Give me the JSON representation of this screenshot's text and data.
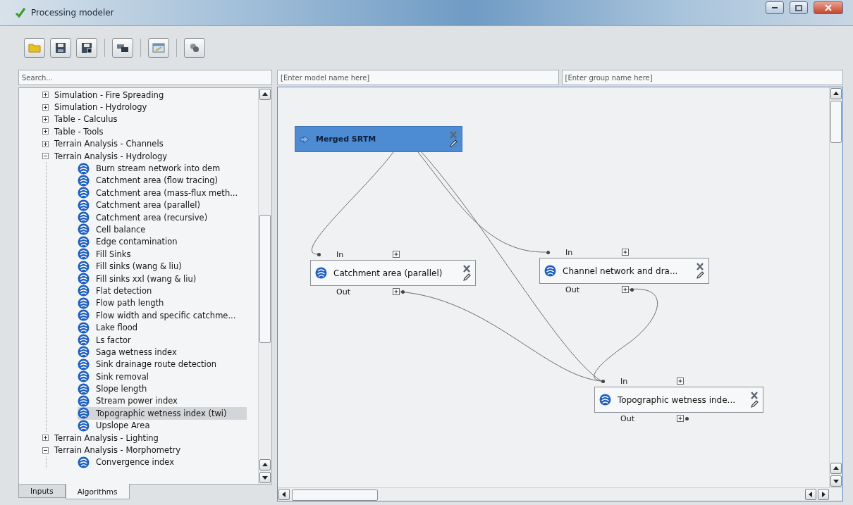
{
  "window": {
    "title": "Processing modeler"
  },
  "search": {
    "placeholder": "Search..."
  },
  "tree": [
    {
      "label": "Simulation - Fire Spreading",
      "expanded": false,
      "selected": false
    },
    {
      "label": "Simulation - Hydrology",
      "expanded": false,
      "selected": false
    },
    {
      "label": "Table - Calculus",
      "expanded": false,
      "selected": false
    },
    {
      "label": "Table - Tools",
      "expanded": false,
      "selected": false
    },
    {
      "label": "Terrain Analysis - Channels",
      "expanded": false,
      "selected": false
    },
    {
      "label": "Terrain Analysis - Hydrology",
      "expanded": true,
      "selected": false,
      "children": [
        {
          "label": "Burn stream network into dem",
          "selected": false
        },
        {
          "label": "Catchment area (flow tracing)",
          "selected": false
        },
        {
          "label": "Catchment area (mass-flux meth...",
          "selected": false
        },
        {
          "label": "Catchment area (parallel)",
          "selected": false
        },
        {
          "label": "Catchment area (recursive)",
          "selected": false
        },
        {
          "label": "Cell balance",
          "selected": false
        },
        {
          "label": "Edge contamination",
          "selected": false
        },
        {
          "label": "Fill Sinks",
          "selected": false
        },
        {
          "label": "Fill sinks (wang & liu)",
          "selected": false
        },
        {
          "label": "Fill sinks xxl (wang & liu)",
          "selected": false
        },
        {
          "label": "Flat detection",
          "selected": false
        },
        {
          "label": "Flow path length",
          "selected": false
        },
        {
          "label": "Flow width and specific catchme...",
          "selected": false
        },
        {
          "label": "Lake flood",
          "selected": false
        },
        {
          "label": "Ls factor",
          "selected": false
        },
        {
          "label": "Saga wetness index",
          "selected": false
        },
        {
          "label": "Sink drainage route detection",
          "selected": false
        },
        {
          "label": "Sink removal",
          "selected": false
        },
        {
          "label": "Slope length",
          "selected": false
        },
        {
          "label": "Stream power index",
          "selected": false
        },
        {
          "label": "Topographic wetness index (twi)",
          "selected": true
        },
        {
          "label": "Upslope Area",
          "selected": false
        }
      ]
    },
    {
      "label": "Terrain Analysis - Lighting",
      "expanded": false,
      "selected": false
    },
    {
      "label": "Terrain Analysis - Morphometry",
      "expanded": true,
      "selected": false,
      "children": [
        {
          "label": "Convergence index",
          "selected": false
        }
      ]
    }
  ],
  "tabs": [
    {
      "label": "Inputs",
      "selected": false
    },
    {
      "label": "Algorithms",
      "selected": true
    }
  ],
  "model_name": {
    "placeholder": "[Enter model name here]"
  },
  "group_name": {
    "placeholder": "[Enter group name here]"
  },
  "nodes": [
    {
      "kind": "input",
      "title": "Merged SRTM",
      "selected": true
    },
    {
      "kind": "algorithm",
      "title": "Catchment area (parallel)",
      "selected": false,
      "input_label": "In",
      "output_label": "Out"
    },
    {
      "kind": "algorithm",
      "title": "Channel network and dra...",
      "selected": false,
      "input_label": "In",
      "output_label": "Out"
    },
    {
      "kind": "algorithm",
      "title": "Topographic wetness inde...",
      "selected": false,
      "input_label": "In",
      "output_label": "Out"
    }
  ]
}
